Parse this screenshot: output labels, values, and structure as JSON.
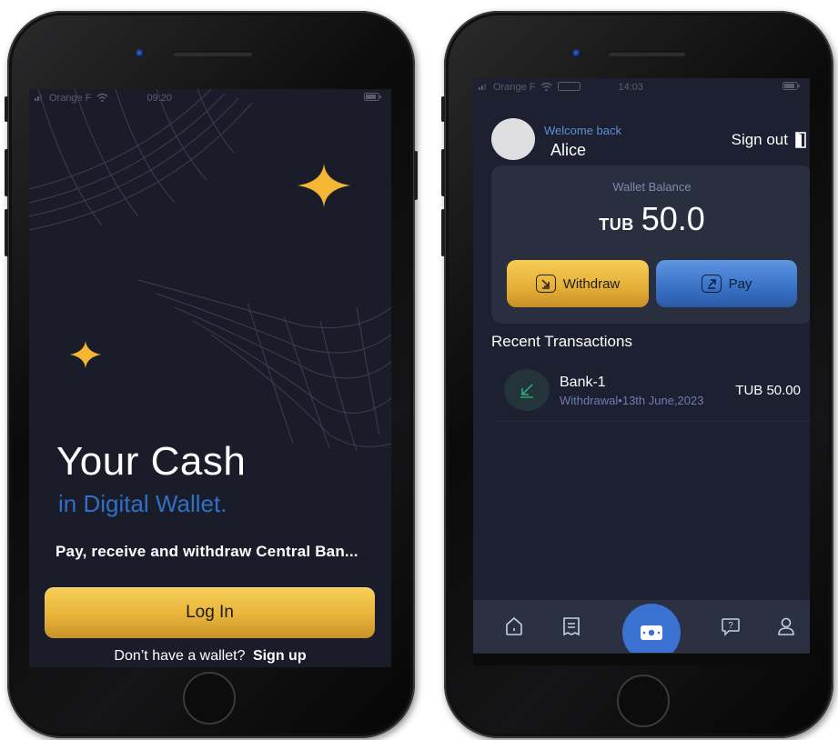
{
  "left_screen": {
    "status": {
      "carrier": "Orange F",
      "time": "09:20"
    },
    "hero_title": "Your Cash",
    "hero_subtitle": "in Digital Wallet.",
    "hero_description": "Pay, receive and withdraw Central Ban...",
    "login_label": "Log In",
    "signup_prompt": "Don’t have a wallet?",
    "signup_link": "Sign up"
  },
  "right_screen": {
    "status": {
      "carrier": "Orange F",
      "time": "14:03"
    },
    "welcome_text": "Welcome back",
    "user_name": "Alice",
    "sign_out_label": "Sign out",
    "wallet": {
      "label": "Wallet Balance",
      "currency": "TUB",
      "amount": "50.0"
    },
    "withdraw_label": "Withdraw",
    "pay_label": "Pay",
    "recent_title": "Recent Transactions",
    "transactions": [
      {
        "name": "Bank-1",
        "meta": "Withdrawal•13th June,2023",
        "amount": "TUB 50.00"
      }
    ],
    "nav": [
      "home-icon",
      "receipt-icon",
      "wallet-icon",
      "help-icon",
      "profile-icon"
    ]
  },
  "colors": {
    "accent_gold": "#e8b43a",
    "accent_blue": "#3b74c9",
    "background": "#1c2030"
  }
}
